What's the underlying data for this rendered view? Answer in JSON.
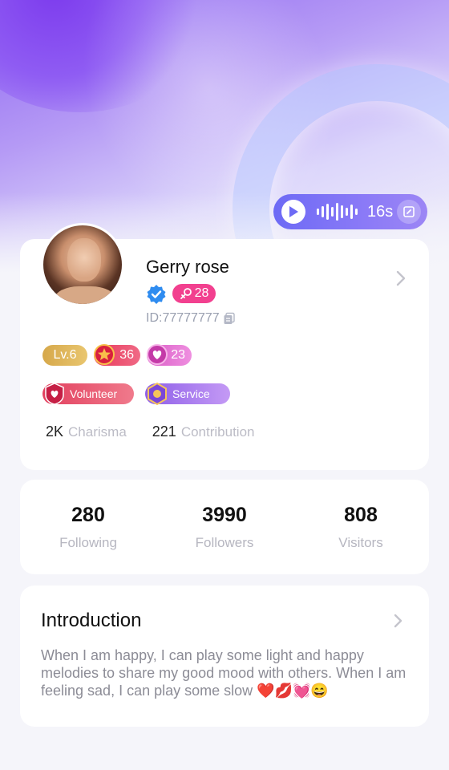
{
  "voice_intro": {
    "duration": "16s"
  },
  "profile": {
    "name": "Gerry rose",
    "gender_age": "28",
    "user_id": "ID:77777777",
    "badges": {
      "level": "Lv.6",
      "red_badge_value": "36",
      "pink_badge_value": "23",
      "volunteer": "Volunteer",
      "service": "Service"
    },
    "charisma": {
      "value": "2K",
      "label": "Charisma"
    },
    "contribution": {
      "value": "221",
      "label": "Contribution"
    }
  },
  "stats": [
    {
      "value": "280",
      "label": "Following"
    },
    {
      "value": "3990",
      "label": "Followers"
    },
    {
      "value": "808",
      "label": "Visitors"
    }
  ],
  "introduction": {
    "title": "Introduction",
    "text": "When I am happy, I can play some light and happy melodies to share my good mood with others. When I am feeling sad, I can play some slow",
    "emojis": "❤️💋💓😄"
  },
  "colors": {
    "accent": "#6d6af5",
    "gender_pink": "#f2408f",
    "verified_blue": "#2f8cf0"
  },
  "icons": [
    "play-icon",
    "voice-wave-icon",
    "edit-icon",
    "verified-icon",
    "female-icon",
    "copy-icon",
    "chevron-right-icon"
  ]
}
